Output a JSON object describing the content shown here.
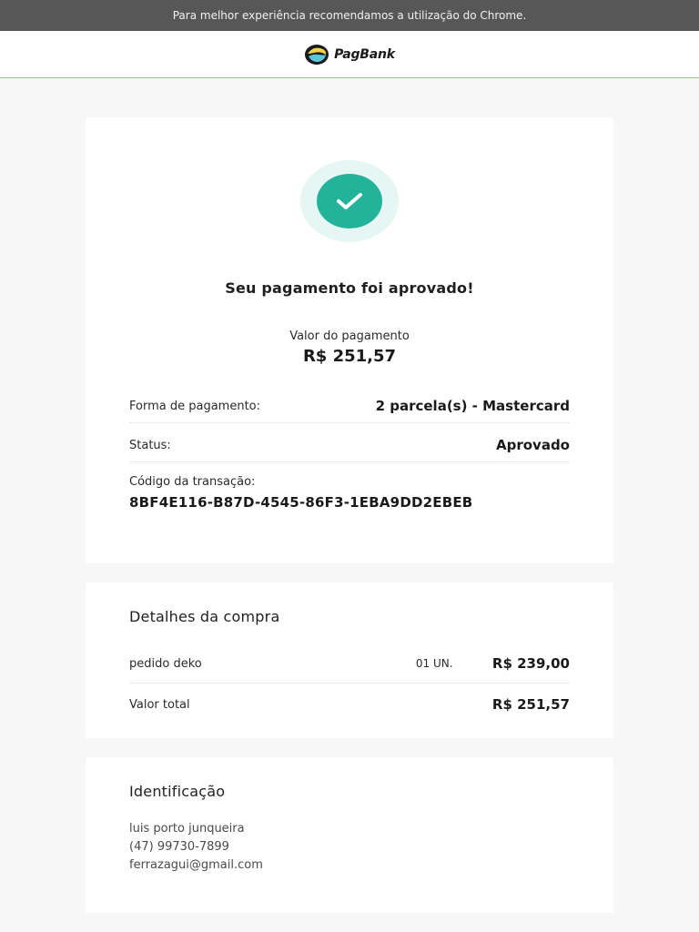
{
  "banner": {
    "text": "Para melhor experiência recomendamos a utilização do Chrome."
  },
  "header": {
    "logo_text": "PagBank",
    "logo_icon": "pagbank-logo-icon"
  },
  "status_card": {
    "icon": "check-icon",
    "title": "Seu pagamento foi aprovado!",
    "amount_label": "Valor do pagamento",
    "amount_value": "R$ 251,57",
    "payment_method_label": "Forma de pagamento:",
    "payment_method_value": "2 parcela(s) - Mastercard",
    "status_label": "Status:",
    "status_value": "Aprovado",
    "transaction_label": "Código da transação:",
    "transaction_value": "8BF4E116-B87D-4545-86F3-1EBA9DD2EBEB"
  },
  "details_card": {
    "title": "Detalhes da compra",
    "items": [
      {
        "name": "pedido deko",
        "qty": "01 UN.",
        "price": "R$ 239,00"
      }
    ],
    "total_label": "Valor total",
    "total_value": "R$ 251,57"
  },
  "identification_card": {
    "title": "Identificação",
    "name": "luis porto junqueira",
    "phone": "(47) 99730-7899",
    "email": "ferrazagui@gmail.com"
  },
  "colors": {
    "success": "#23b39a",
    "success_halo": "#e6f6f3",
    "banner_bg": "#575757",
    "header_border": "#8fd17a"
  }
}
